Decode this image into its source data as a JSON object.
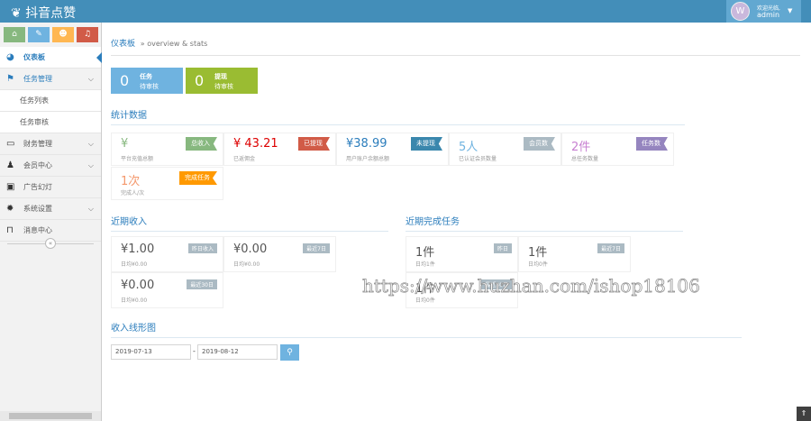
{
  "app": {
    "title": "抖音点赞",
    "welcome": "欢迎光临,",
    "user": "admin"
  },
  "sidebar": {
    "items": [
      {
        "label": "仪表板",
        "icon": "dashboard-icon"
      },
      {
        "label": "任务管理",
        "icon": "flag-icon"
      },
      {
        "label": "任务列表"
      },
      {
        "label": "任务审核"
      },
      {
        "label": "财务管理",
        "icon": "inbox-icon"
      },
      {
        "label": "会员中心",
        "icon": "user-icon"
      },
      {
        "label": "广告幻灯",
        "icon": "picture-icon"
      },
      {
        "label": "系统设置",
        "icon": "gear-icon"
      },
      {
        "label": "消息中心",
        "icon": "bookmark-icon"
      }
    ]
  },
  "breadcrumb": {
    "root": "仪表板",
    "sub": "» overview & stats"
  },
  "tiles": [
    {
      "num": "0",
      "a": "任务",
      "b": "待审核"
    },
    {
      "num": "0",
      "a": "提现",
      "b": "待审核"
    }
  ],
  "stats": {
    "title": "统计数据",
    "cells": [
      {
        "value": "¥",
        "label": "平台充值总额",
        "tag": "总收入",
        "color": "#87b87f",
        "tagc": "#87b87f"
      },
      {
        "value": "¥ 43.21",
        "label": "已返佣金",
        "tag": "已提现",
        "color": "#dd0000",
        "tagc": "#d15b47"
      },
      {
        "value": "¥38.99",
        "label": "用户账户余额总额",
        "tag": "未提现",
        "color": "#2b7dbc",
        "tagc": "#3a87ad"
      },
      {
        "value": "5人",
        "label": "已认证会员数量",
        "tag": "会员数",
        "color": "#6fb3e0",
        "tagc": "#abbac3"
      },
      {
        "value": "2件",
        "label": "总任务数量",
        "tag": "任务数",
        "color": "#c77fd1",
        "tagc": "#9585bf"
      },
      {
        "value": "1次",
        "label": "完成人/次",
        "tag": "完成任务",
        "color": "#f4986c",
        "tagc": "#ff9900"
      }
    ]
  },
  "income": {
    "title": "近期收入",
    "boxes": [
      {
        "value": "¥1.00",
        "label": "日均¥0.00",
        "tag": "昨日收入"
      },
      {
        "value": "¥0.00",
        "label": "日均¥0.00",
        "tag": "最近7日"
      },
      {
        "value": "¥0.00",
        "label": "日均¥0.00",
        "tag": "最近30日"
      }
    ]
  },
  "tasks": {
    "title": "近期完成任务",
    "boxes": [
      {
        "value": "1件",
        "label": "日均1件",
        "tag": "昨日"
      },
      {
        "value": "1件",
        "label": "日均0件",
        "tag": "最近7日"
      },
      {
        "value": "1件",
        "label": "日均0件",
        "tag": "最近30日"
      }
    ]
  },
  "chart": {
    "title": "收入线形图",
    "start": "2019-07-13",
    "sep": "-",
    "end": "2019-08-12"
  },
  "watermark": "https://www.huzhan.com/ishop18106"
}
